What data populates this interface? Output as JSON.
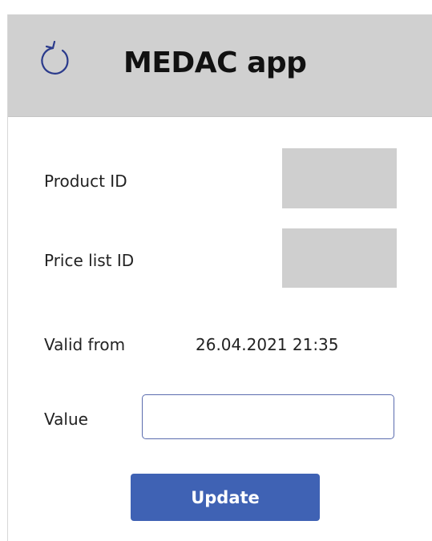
{
  "header": {
    "title": "MEDAC app",
    "refresh_icon": "refresh-icon"
  },
  "form": {
    "product_id_label": "Product ID",
    "product_id_value": "",
    "price_list_id_label": "Price list ID",
    "price_list_id_value": "",
    "valid_from_label": "Valid from",
    "valid_from_value": "26.04.2021 21:35",
    "value_label": "Value",
    "value_input": "",
    "update_label": "Update"
  },
  "colors": {
    "header_background": "#d0d0d0",
    "accent": "#3f62b4",
    "input_border": "#5b6cae",
    "icon": "#2b3b8c",
    "placeholder_box": "#cfcfcf"
  }
}
